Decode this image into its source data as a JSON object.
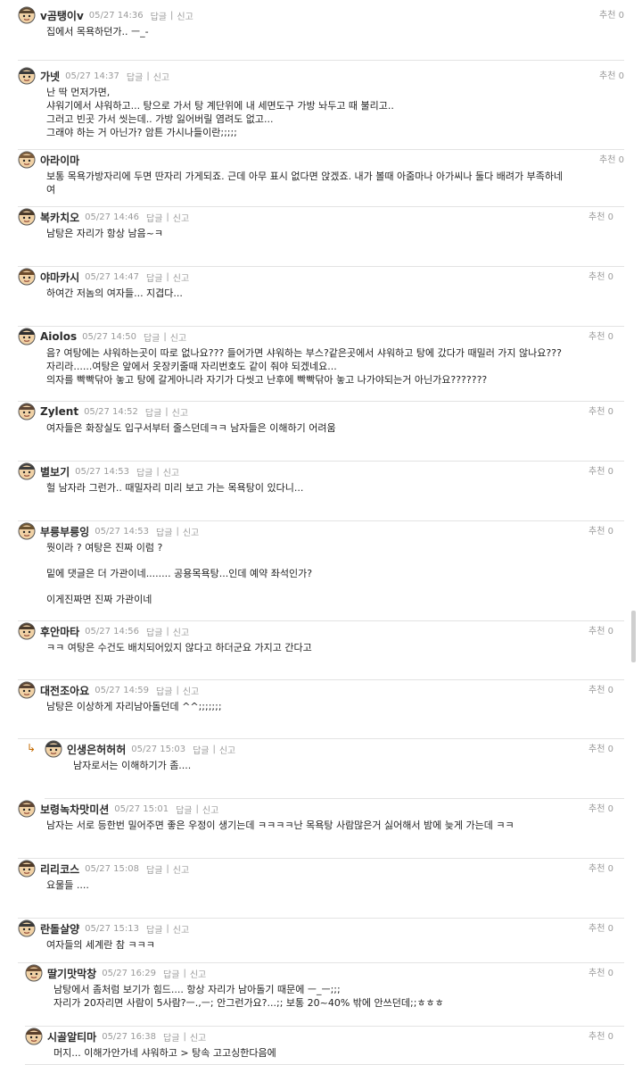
{
  "actions": {
    "reply": "답글",
    "report": "신고",
    "recommend": "추천 0"
  },
  "comments": [
    {
      "nick": "v곰탱이v",
      "date": "05/27 14:36",
      "lines": [
        "집에서 목욕하던가.. ㅡ_-"
      ]
    },
    {
      "nick": "가넷",
      "date": "05/27 14:37",
      "lines": [
        "난 딱 먼저가면,",
        "샤워기에서 샤워하고... 탕으로 가서 탕 계단위에 내 세면도구 가방 놔두고 때 불리고..",
        "그러고 빈곳 가서 씻는데.. 가방 잃어버릴 염려도 없고...",
        "그래야 하는 거 아닌가? 암튼 가시나들이란;;;;;"
      ]
    },
    {
      "nick": "아라이마",
      "date": "",
      "lines": [
        "보통 목욕가방자리에 두면 딴자리 가게되죠. 근데 아무 표시 없다면 앉겠죠. 내가 볼때 아줌마나 아가씨나 둘다 배려가 부족하네",
        "여"
      ]
    },
    {
      "nick": "복카치오",
      "date": "05/27 14:46",
      "lines": [
        "남탕은 자리가 항상 남음~ㅋ"
      ]
    },
    {
      "nick": "야마카시",
      "date": "05/27 14:47",
      "lines": [
        "하여간 저놈의 여자들... 지겹다..."
      ]
    },
    {
      "nick": "Aiolos",
      "date": "05/27 14:50",
      "lines": [
        "음? 여탕에는 샤워하는곳이 따로 없나요??? 들어가면 샤워하는 부스?같은곳에서 샤워하고 탕에 갔다가 때밀러 가지 않나요???",
        "자리라......여탕은 앞에서 옷장키줄때 자리번호도 같이 줘야 되겠네요...",
        "의자를 빡빡닦아 놓고 탕에 갈게아니라 자기가 다씻고 난후에 빡빡닦아 놓고 나가야되는거 아닌가요???????"
      ]
    },
    {
      "nick": "Zylent",
      "date": "05/27 14:52",
      "lines": [
        "여자들은 화장실도 입구서부터 줄스던데ㅋㅋ 남자들은 이해하기 어려움"
      ]
    },
    {
      "nick": "별보기",
      "date": "05/27 14:53",
      "lines": [
        "헐 남자라 그런가.. 때밀자리 미리 보고 가는 목욕탕이 있다니..."
      ]
    },
    {
      "nick": "부릉부릉잉",
      "date": "05/27 14:53",
      "lines": [
        "뭣이라 ? 여탕은 진짜 이럼 ?",
        "",
        "밑에 댓글은 더 가관이네........ 공용목욕탕...인데 예약 좌석인가?",
        "",
        "이게진짜면 진짜 가관이네"
      ]
    },
    {
      "nick": "후안마타",
      "date": "05/27 14:56",
      "lines": [
        "ㅋㅋ 여탕은 수건도 배치되어있지 않다고 하더군요 가지고 간다고"
      ]
    },
    {
      "nick": "대전조아요",
      "date": "05/27 14:59",
      "lines": [
        "남탕은 이상하게 자리남아돌던데 ^^;;;;;;;"
      ]
    },
    {
      "nick": "인생은허허허",
      "date": "05/27 15:03",
      "reply_mark": "↳",
      "lines": [
        "남자로서는 이해하기가 좀...."
      ]
    },
    {
      "nick": "보령녹차맛미션",
      "date": "05/27 15:01",
      "lines": [
        "남자는 서로 등한번 밀어주면 좋은 우정이 생기는데 ㅋㅋㅋㅋ난 목욕탕 사람많은거 싫어해서 밤에 늦게 가는데 ㅋㅋ"
      ]
    },
    {
      "nick": "리리코스",
      "date": "05/27 15:08",
      "lines": [
        "요물들 ...."
      ]
    },
    {
      "nick": "란돌살양",
      "date": "05/27 15:13",
      "lines": [
        "여자들의 세계란 참 ㅋㅋㅋ"
      ]
    },
    {
      "nick": "딸기맛막창",
      "date": "05/27 16:29",
      "lines": [
        "남탕에서 좀처럼 보기가 힘드.... 항상 자리가 남아돌기 때문에 ㅡ_ㅡ;;;",
        "자리가 20자리면 사람이 5사람?ㅡ.,ㅡ; 안그런가요?...;; 보통 20~40% 밖에 안쓰던데;;ㅎㅎㅎ"
      ]
    },
    {
      "nick": "시골알티마",
      "date": "05/27 16:38",
      "lines": [
        "머지... 이해가안가네 샤워하고 > 탕속 고고싱한다음에"
      ]
    }
  ],
  "avatar_colors": [
    "#5a4630",
    "#3b3b3b",
    "#7a5a3a",
    "#4a3a2a",
    "#6b4a2b",
    "#2f2f2f",
    "#5d4636",
    "#3e3e3e",
    "#6a5230",
    "#4b3b2b",
    "#564030",
    "#3c3c3c",
    "#5e4533",
    "#4e3a28",
    "#3a3a3a",
    "#6a4c32",
    "#5b412c"
  ]
}
